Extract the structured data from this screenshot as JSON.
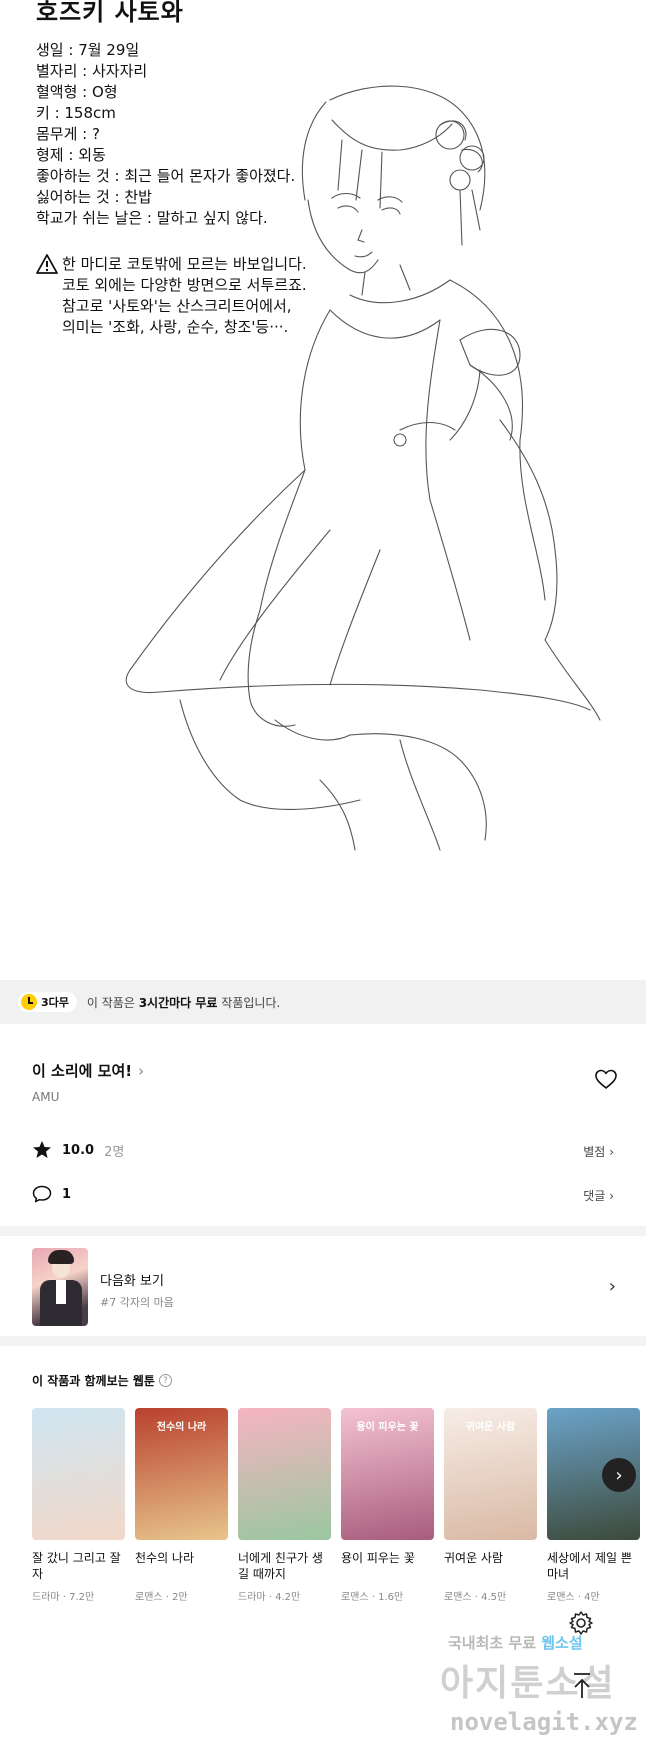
{
  "comic": {
    "character_name": "호즈키 사토와",
    "profile_lines": [
      "생일 : 7월 29일",
      "별자리 : 사자자리",
      "혈액형 : O형",
      "키 : 158cm",
      "몸무게 : ?",
      "형제 : 외동",
      "좋아하는 것 : 최근 들어 몬자가 좋아졌다.",
      "싫어하는 것 : 찬밥",
      "학교가 쉬는 날은 : 말하고 싶지 않다."
    ],
    "warning_lines": [
      "한 마디로 코토밖에 모르는 바보입니다.",
      "코토 외에는 다양한 방면으로 서투르죠.",
      "참고로 '사토와'는 산스크리트어에서,",
      "의미는 '조화, 사랑, 순수, 창조'등···."
    ]
  },
  "free_banner": {
    "badge": "3다무",
    "text_before": "이 작품은 ",
    "text_bold": "3시간마다 무료",
    "text_after": " 작품입니다."
  },
  "work": {
    "title": "이 소리에 모여!",
    "author": "AMU",
    "rating": "10.0",
    "rating_count": "2명",
    "rate_link": "별점",
    "comments": "1",
    "comment_link": "댓글"
  },
  "next_episode": {
    "label": "다음화 보기",
    "subtitle": "#7 각자의 마음"
  },
  "recommendations": {
    "heading": "이 작품과 함께보는 웹툰",
    "items": [
      {
        "title": "잘 갔니 그리고 잘 자",
        "meta": "드라마 · 7.2만",
        "color1": "#cfe6f2",
        "color2": "#f2d8c9",
        "cover_text": ""
      },
      {
        "title": "천수의 나라",
        "meta": "로맨스 · 2만",
        "color1": "#b9412e",
        "color2": "#e7c58b",
        "cover_text": "천수의 나라"
      },
      {
        "title": "너에게 친구가 생길 때까지",
        "meta": "드라마 · 4.2만",
        "color1": "#f6b4c1",
        "color2": "#9ac7a0",
        "cover_text": ""
      },
      {
        "title": "용이 피우는 꽃",
        "meta": "로맨스 · 1.6만",
        "color1": "#f4c3d2",
        "color2": "#a85c7c",
        "cover_text": "용이 피우는 꽃"
      },
      {
        "title": "귀여운 사람",
        "meta": "로맨스 · 4.5만",
        "color1": "#f7ede7",
        "color2": "#d9b9a4",
        "cover_text": "귀여운 사람"
      },
      {
        "title": "세상에서 제일 쁜 마녀",
        "meta": "로맨스 · 4만",
        "color1": "#6ba3c9",
        "color2": "#3d4a3a",
        "cover_text": ""
      }
    ]
  },
  "watermark": {
    "line1_a": "국내최초 무료 ",
    "line1_b": "웹소설",
    "line2": "아지툰소설",
    "line3": "novelagit.xyz"
  },
  "icons": {
    "heart": "heart-icon",
    "star": "star-icon",
    "comment": "comment-icon",
    "settings": "gear-icon",
    "scroll_top": "arrow-up-icon"
  },
  "colors": {
    "accent_yellow": "#ffcd00",
    "banner_bg": "#f1f1f1",
    "divider": "#f3f3f3"
  }
}
